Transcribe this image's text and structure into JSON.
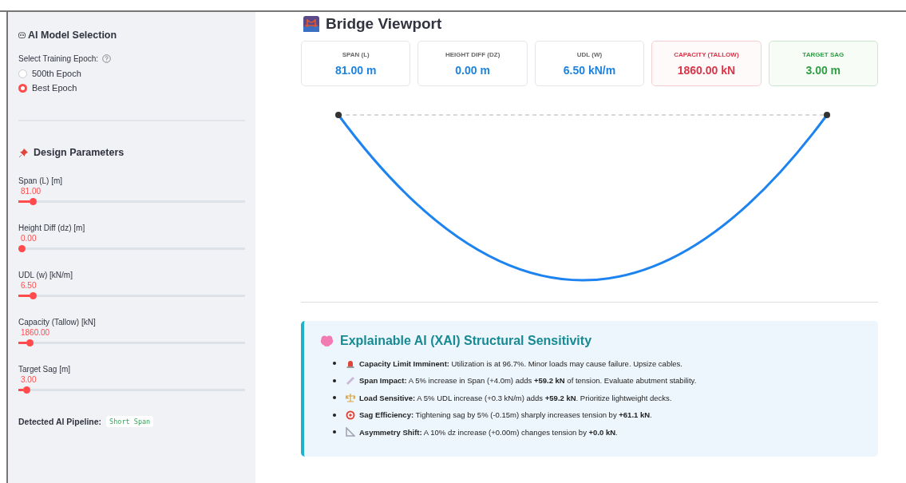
{
  "sidebar": {
    "model_section": {
      "title": "AI Model Selection",
      "question": "Select Training Epoch:",
      "options": [
        {
          "label": "500th Epoch",
          "selected": false
        },
        {
          "label": "Best Epoch",
          "selected": true
        }
      ]
    },
    "design_section": {
      "title": "Design Parameters",
      "sliders": [
        {
          "label": "Span (L) [m]",
          "reading": "81.00",
          "level": 0.05
        },
        {
          "label": "Height Diff (dz) [m]",
          "reading": "0.00",
          "level": 0.0
        },
        {
          "label": "UDL (w) [kN/m]",
          "reading": "6.50",
          "level": 0.05
        },
        {
          "label": "Capacity (Tallow) [kN]",
          "reading": "1860.00",
          "level": 0.035
        },
        {
          "label": "Target Sag [m]",
          "reading": "3.00",
          "level": 0.02
        }
      ]
    },
    "pipeline": {
      "label": "Detected AI Pipeline:",
      "value": "Short Span"
    }
  },
  "main": {
    "title": "Bridge Viewport",
    "metrics": [
      {
        "label": "SPAN (L)",
        "value": "81.00 m",
        "kind": "info"
      },
      {
        "label": "HEIGHT DIFF (DZ)",
        "value": "0.00 m",
        "kind": "info"
      },
      {
        "label": "UDL (W)",
        "value": "6.50 kN/m",
        "kind": "info"
      },
      {
        "label": "CAPACITY (TALLOW)",
        "value": "1860.00 kN",
        "kind": "danger"
      },
      {
        "label": "TARGET SAG",
        "value": "3.00 m",
        "kind": "success"
      }
    ],
    "xai": {
      "title": "Explainable AI (XAI) Structural Sensitivity",
      "items": [
        "**Capacity Limit Imminent:** Utilization is at 96.7%. Minor loads may cause failure. Upsize cables.",
        "**Span Impact:** A 5% increase in Span (+4.0m) adds **+59.2 kN** of tension. Evaluate abutment stability.",
        "**Load Sensitive:** A 5% UDL increase (+0.3 kN/m) adds **+59.2 kN**. Prioritize lightweight decks.",
        "**Sag Efficiency:** Tightening sag by 5% (-0.15m) sharply increases tension by **+61.1 kN**.",
        "**Asymmetry Shift:** A 10% dz increase (+0.00m) changes tension by **+0.0 kN**."
      ]
    }
  }
}
